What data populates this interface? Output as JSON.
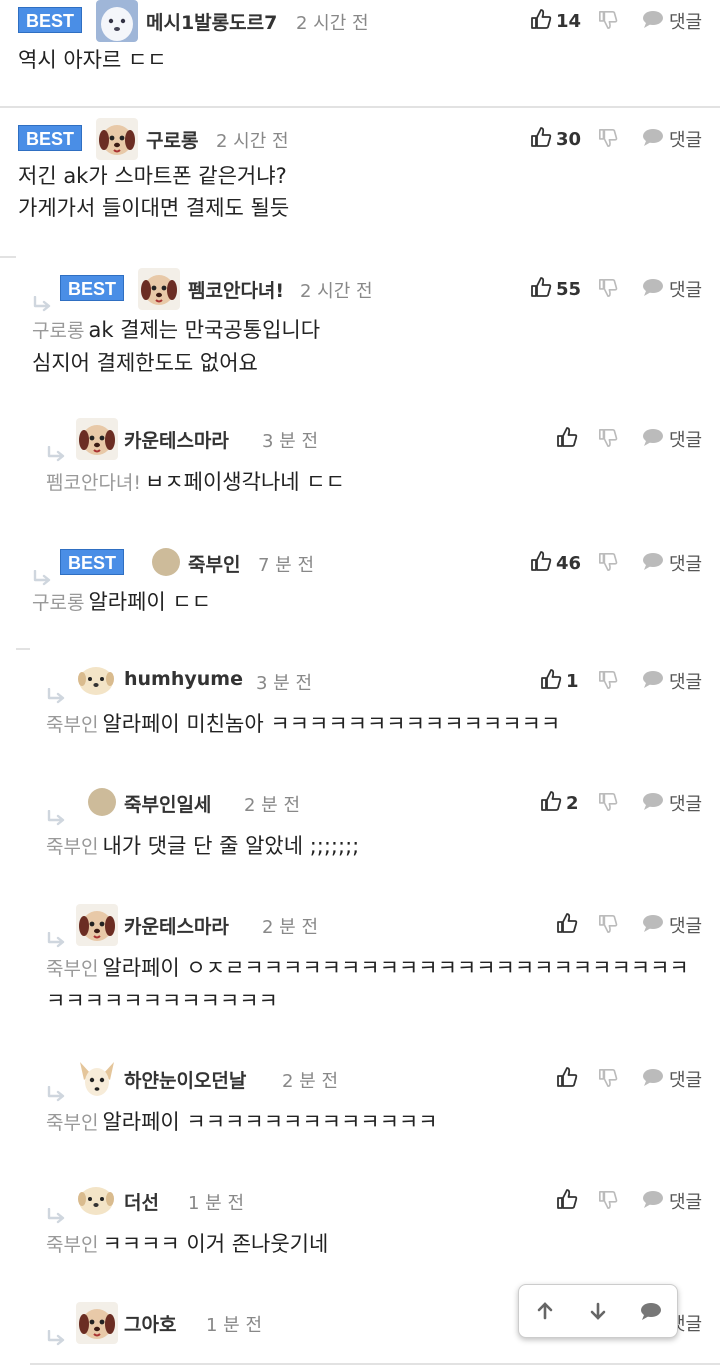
{
  "labels": {
    "best": "BEST",
    "reply": "댓글"
  },
  "colors": {
    "best_bg": "#4a8ee6",
    "icon_gray": "#bbbbbb",
    "text_dark": "#333333"
  },
  "comments": [
    {
      "nick": "메시1발롱도르7",
      "time": "2 시간 전",
      "likes": "14",
      "mention": "",
      "body": "역시 아자르 ㄷㄷ",
      "best": true,
      "level": 0,
      "avatar": "white-dog-avatar"
    },
    {
      "nick": "구로롱",
      "time": "2 시간 전",
      "likes": "30",
      "mention": "",
      "body": "저긴 ak가 스마트폰 같은거냐?\n가게가서 들이대면 결제도 될듯",
      "best": true,
      "level": 0,
      "avatar": "dog-face-avatar"
    },
    {
      "nick": "펨코안다녀!",
      "time": "2 시간 전",
      "likes": "55",
      "mention": "구로롱",
      "body": "ak 결제는 만국공통입니다\n심지어 결제한도도 없어요",
      "best": true,
      "level": 1,
      "avatar": "dog-face-avatar"
    },
    {
      "nick": "카운테스마라",
      "time": "3 분 전",
      "likes": "",
      "mention": "펨코안다녀!",
      "body": "ㅂㅈ페이생각나네 ㄷㄷ",
      "best": false,
      "level": 2,
      "avatar": "dog-face-avatar"
    },
    {
      "nick": "죽부인",
      "time": "7 분 전",
      "likes": "46",
      "mention": "구로롱",
      "body": "알라페이 ㄷㄷ",
      "best": true,
      "level": 1,
      "avatar": "beige-circle-avatar"
    },
    {
      "nick": "humhyume",
      "time": "3 분 전",
      "likes": "1",
      "mention": "죽부인",
      "body": "알라페이 미친놈아 ㅋㅋㅋㅋㅋㅋㅋㅋㅋㅋㅋㅋㅋㅋㅋ",
      "best": false,
      "level": 2,
      "avatar": "puppy-avatar"
    },
    {
      "nick": "죽부인일세",
      "time": "2 분 전",
      "likes": "2",
      "mention": "죽부인",
      "body": "내가 댓글 단 줄 알았네 ;;;;;;;",
      "best": false,
      "level": 2,
      "avatar": "beige-circle-avatar"
    },
    {
      "nick": "카운테스마라",
      "time": "2 분 전",
      "likes": "",
      "mention": "죽부인",
      "body": "알라페이 ㅇㅈㄹㅋㅋㅋㅋㅋㅋㅋㅋㅋㅋㅋㅋㅋㅋㅋㅋㅋㅋㅋㅋㅋㅋㅋ\nㅋㅋㅋㅋㅋㅋㅋㅋㅋㅋㅋㅋ",
      "best": false,
      "level": 2,
      "avatar": "dog-face-avatar"
    },
    {
      "nick": "하얀눈이오던날",
      "time": "2 분 전",
      "likes": "",
      "mention": "죽부인",
      "body": "알라페이 ㅋㅋㅋㅋㅋㅋㅋㅋㅋㅋㅋㅋㅋ",
      "best": false,
      "level": 2,
      "avatar": "chihuahua-avatar"
    },
    {
      "nick": "더선",
      "time": "1 분 전",
      "likes": "",
      "mention": "죽부인",
      "body": "ㅋㅋㅋㅋ 이거 존나웃기네",
      "best": false,
      "level": 2,
      "avatar": "puppy-avatar"
    },
    {
      "nick": "그아호",
      "time": "1 분 전",
      "likes": "",
      "mention": "",
      "body": "",
      "best": false,
      "level": 2,
      "avatar": "dog-face-avatar"
    }
  ]
}
